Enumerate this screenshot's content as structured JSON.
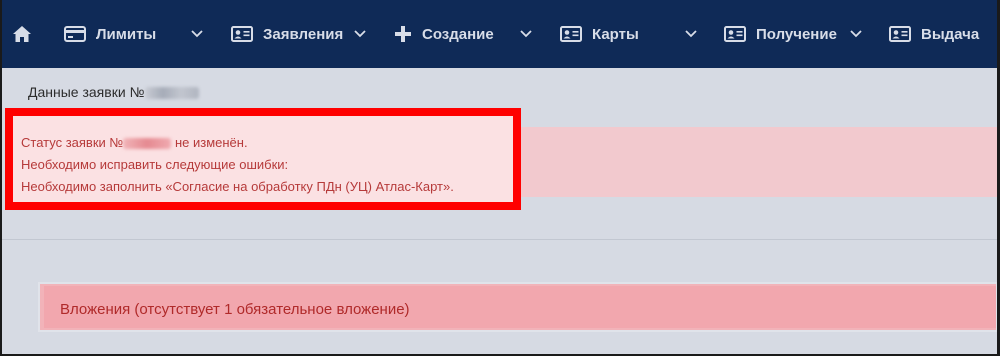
{
  "navbar": {
    "items": [
      {
        "label": "Лимиты",
        "icon": "credit-card-icon"
      },
      {
        "label": "Заявления",
        "icon": "id-card-icon"
      },
      {
        "label": "Создание",
        "icon": "plus-icon"
      },
      {
        "label": "Карты",
        "icon": "id-card-icon"
      },
      {
        "label": "Получение",
        "icon": "id-card-icon"
      },
      {
        "label": "Выдача",
        "icon": "id-card-icon"
      }
    ],
    "home_icon": "home-icon",
    "background": "#0f2a57"
  },
  "page": {
    "title_prefix": "Данные заявки №"
  },
  "alert": {
    "line1_prefix": "Статус заявки №",
    "line1_suffix": " не изменён.",
    "line2": "Необходимо исправить следующие ошибки:",
    "line3": "Необходимо заполнить «Согласие на обработку ПДн (УЦ) Атлас-Карт».",
    "text_color": "#b63a3a",
    "highlight_color": "#ff0000"
  },
  "attachments": {
    "title": "Вложения (отсутствует 1 обязательное вложение)"
  }
}
